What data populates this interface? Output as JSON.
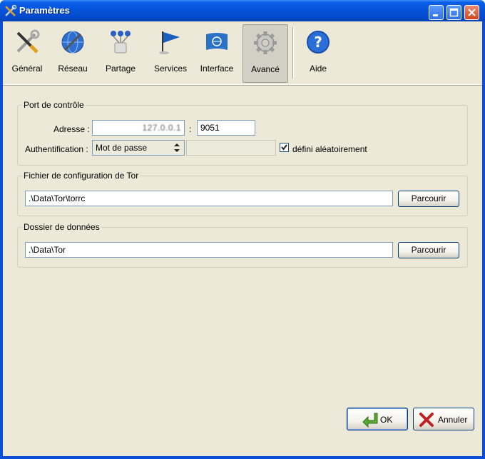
{
  "window": {
    "title": "Paramètres"
  },
  "toolbar": {
    "items": [
      {
        "label": "Général"
      },
      {
        "label": "Réseau"
      },
      {
        "label": "Partage"
      },
      {
        "label": "Services"
      },
      {
        "label": "Interface"
      },
      {
        "label": "Avancé"
      },
      {
        "label": "Aide"
      }
    ],
    "active": "Avancé"
  },
  "control_port": {
    "title": "Port de contrôle",
    "address_label": "Adresse :",
    "address_value": "127.0.0.1",
    "colon": ":",
    "port_value": "9051",
    "auth_label": "Authentification :",
    "auth_selected": "Mot de passe",
    "password_value": "",
    "random_label": "défini aléatoirement",
    "random_checked": true
  },
  "torrc": {
    "title": "Fichier de configuration de Tor",
    "path": ".\\Data\\Tor\\torrc",
    "browse_label": "Parcourir"
  },
  "data_dir": {
    "title": "Dossier de données",
    "path": ".\\Data\\Tor",
    "browse_label": "Parcourir"
  },
  "footer": {
    "ok_label": "OK",
    "cancel_label": "Annuler"
  },
  "colors": {
    "title_bar": "#0452d9",
    "dialog_bg": "#ece9d8",
    "field_border": "#7f9db9"
  }
}
